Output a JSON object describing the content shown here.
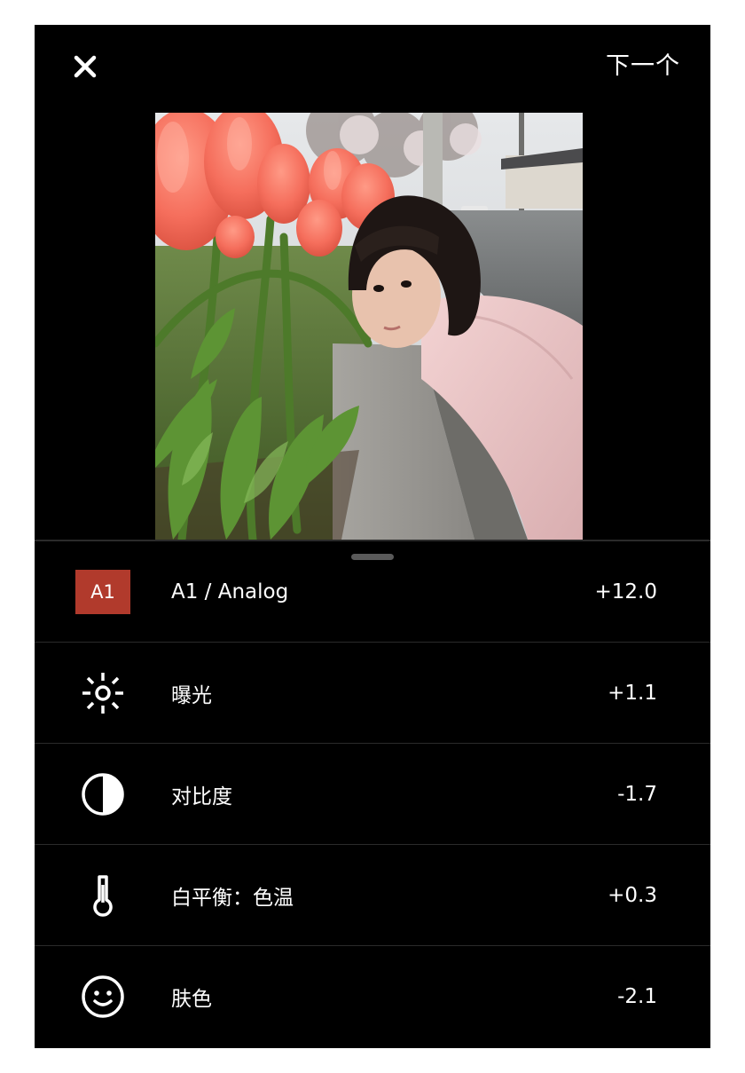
{
  "header": {
    "close_label": "close",
    "next_label": "下一个"
  },
  "adjustments": [
    {
      "icon": "preset-badge",
      "badge": "A1",
      "label": "A1 / Analog",
      "value": "+12.0"
    },
    {
      "icon": "sun-icon",
      "label": "曝光",
      "value": "+1.1"
    },
    {
      "icon": "half-circle-contrast-icon",
      "label": "对比度",
      "value": "-1.7"
    },
    {
      "icon": "thermometer-icon",
      "label": "白平衡：色温",
      "value": "+0.3"
    },
    {
      "icon": "smiley-face-icon",
      "label": "肤色",
      "value": "-2.1"
    }
  ],
  "colors": {
    "background": "#000000",
    "badge": "#b13a2c",
    "divider": "#2b2b2b",
    "text": "#ffffff"
  }
}
